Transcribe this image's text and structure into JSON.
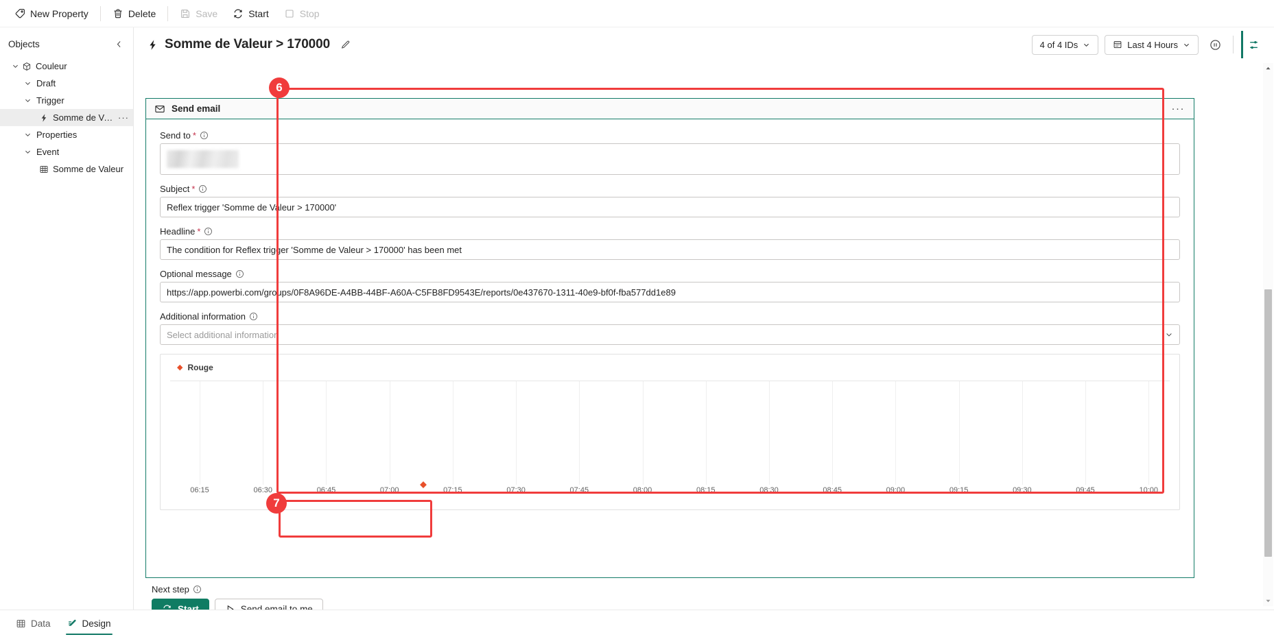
{
  "toolbar": {
    "items": [
      {
        "label": "New Property",
        "icon": "tag-icon",
        "disabled": false
      },
      {
        "label": "Delete",
        "icon": "trash-icon",
        "disabled": false
      },
      {
        "label": "Save",
        "icon": "save-icon",
        "disabled": true
      },
      {
        "label": "Start",
        "icon": "refresh-icon",
        "disabled": false
      },
      {
        "label": "Stop",
        "icon": "stop-icon",
        "disabled": true
      }
    ]
  },
  "sidebar": {
    "title": "Objects",
    "collapse_icon": "chevron-left-icon",
    "tree": [
      {
        "label": "Couleur",
        "icon": "cube-icon",
        "indent": 0,
        "chevron": "chevron-down-icon",
        "selected": false,
        "more": false
      },
      {
        "label": "Draft",
        "icon": "",
        "indent": 1,
        "chevron": "chevron-down-icon",
        "selected": false,
        "more": false
      },
      {
        "label": "Trigger",
        "icon": "",
        "indent": 1,
        "chevron": "chevron-down-icon",
        "selected": false,
        "more": false
      },
      {
        "label": "Somme de Val...",
        "icon": "bolt-icon",
        "indent": 2,
        "chevron": "",
        "selected": true,
        "more": true
      },
      {
        "label": "Properties",
        "icon": "",
        "indent": 1,
        "chevron": "chevron-down-icon",
        "selected": false,
        "more": false
      },
      {
        "label": "Event",
        "icon": "",
        "indent": 1,
        "chevron": "chevron-down-icon",
        "selected": false,
        "more": false
      },
      {
        "label": "Somme de Valeur",
        "icon": "table-icon",
        "indent": 2,
        "chevron": "",
        "selected": false,
        "more": false
      }
    ]
  },
  "header": {
    "title": "Somme de Valeur > 170000",
    "title_icon": "bolt-icon",
    "edit_icon": "pencil-icon",
    "id_filter": "4 of 4 IDs",
    "time_range": "Last 4 Hours",
    "time_icon": "calendar-icon",
    "pause_icon": "pause-icon",
    "settings_icon": "sliders-icon"
  },
  "card": {
    "title": "Send email",
    "icon": "envelope-icon",
    "more_label": "···",
    "fields": {
      "send_to": {
        "label": "Send to",
        "required": "*",
        "info_icon": "info-icon",
        "value": ""
      },
      "subject": {
        "label": "Subject",
        "required": "*",
        "info_icon": "info-icon",
        "value": "Reflex trigger 'Somme de Valeur > 170000'"
      },
      "headline": {
        "label": "Headline",
        "required": "*",
        "info_icon": "info-icon",
        "value": "The condition for Reflex trigger 'Somme de Valeur > 170000' has been met"
      },
      "optional_message": {
        "label": "Optional message",
        "info_icon": "info-icon",
        "value": "https://app.powerbi.com/groups/0F8A96DE-A4BB-44BF-A60A-C5FB8FD9543E/reports/0e437670-1311-40e9-bf0f-fba577dd1e89"
      },
      "additional_information": {
        "label": "Additional information",
        "info_icon": "info-icon",
        "placeholder": "Select additional information",
        "caret_icon": "chevron-down-icon"
      }
    }
  },
  "chart_data": {
    "type": "scatter",
    "title": "",
    "xlabel": "",
    "ylabel": "",
    "legend": [
      {
        "name": "Rouge",
        "color": "#e8502a",
        "marker": "diamond"
      }
    ],
    "legend_position": "top-left",
    "grid": true,
    "x_ticks": [
      "06:15",
      "06:30",
      "06:45",
      "07:00",
      "07:15",
      "07:30",
      "07:45",
      "08:00",
      "08:15",
      "08:30",
      "08:45",
      "09:00",
      "09:15",
      "09:30",
      "09:45",
      "10:00"
    ],
    "xlim": [
      "06:08",
      "10:05"
    ],
    "y_ticks": [],
    "series": [
      {
        "name": "Rouge",
        "color": "#e8502a",
        "points": [
          {
            "x": "07:08",
            "y": 0
          }
        ]
      }
    ]
  },
  "next_step": {
    "label": "Next step",
    "info_icon": "info-icon",
    "start_label": "Start",
    "start_icon": "refresh-icon",
    "send_to_me_label": "Send email to me",
    "send_to_me_icon": "play-icon"
  },
  "annotations": [
    {
      "number": "6",
      "color": "#f03c3c"
    },
    {
      "number": "7",
      "color": "#f03c3c"
    }
  ],
  "scrollbar": {
    "up_icon": "caret-up-icon",
    "down_icon": "caret-down-icon"
  },
  "statusbar": {
    "tabs": [
      {
        "label": "Data",
        "icon": "table-icon",
        "active": false
      },
      {
        "label": "Design",
        "icon": "pencil-edit-icon",
        "active": true
      }
    ]
  }
}
